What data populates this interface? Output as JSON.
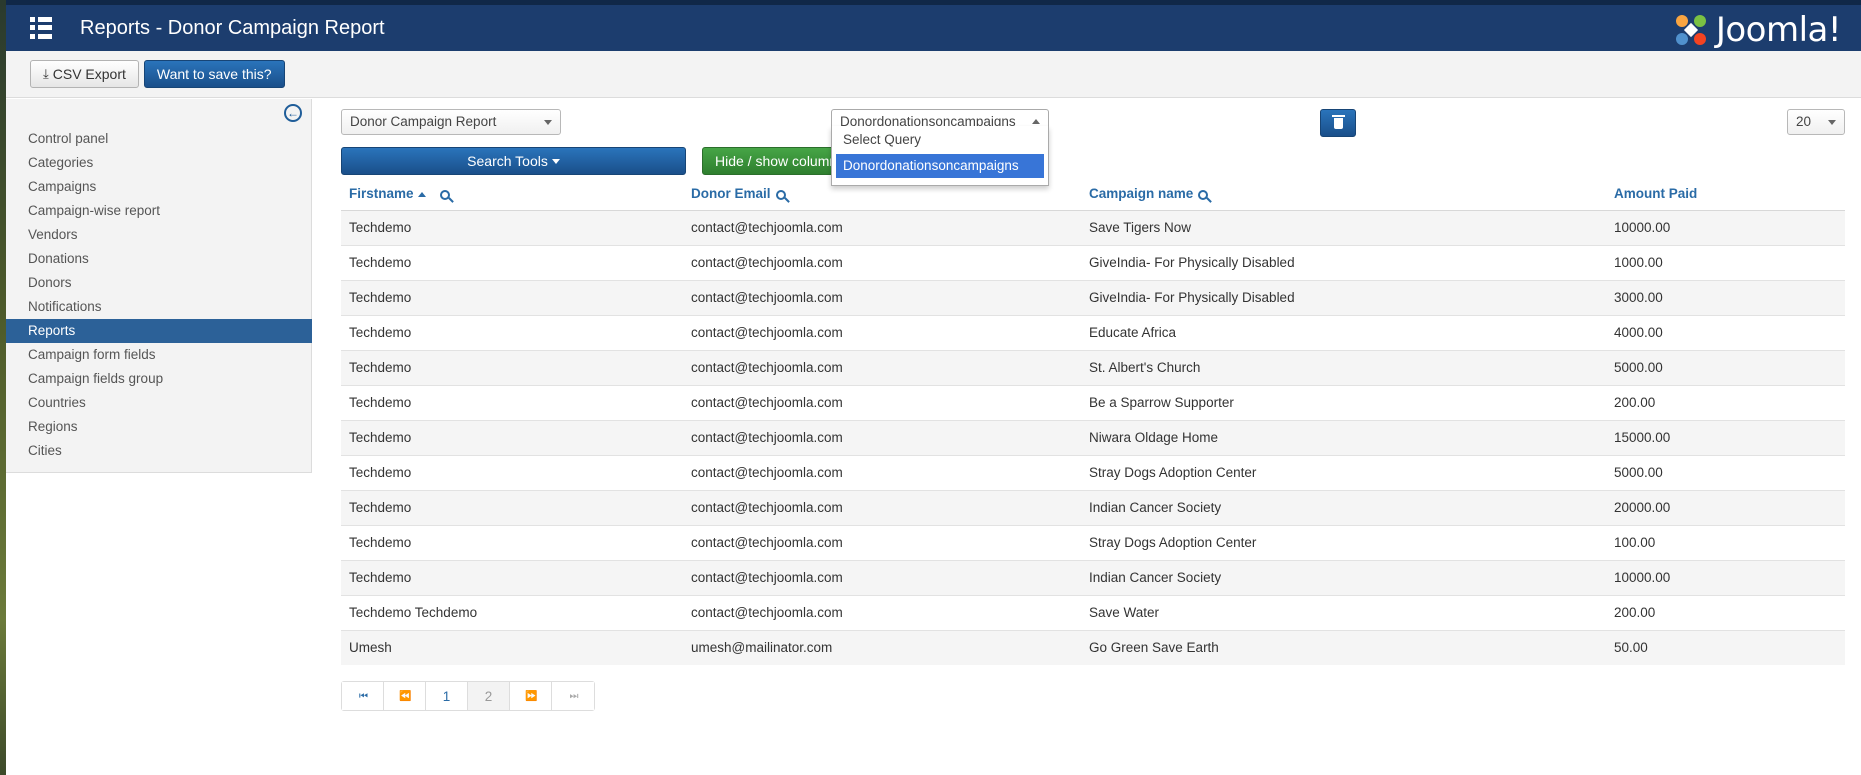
{
  "header": {
    "title": "Reports - Donor Campaign Report",
    "brand": "Joomla!",
    "menu_icon": "list-icon"
  },
  "toolbar": {
    "csv_label": "CSV Export",
    "save_label": "Want to save this?"
  },
  "sidebar": {
    "items": [
      {
        "label": "Control panel"
      },
      {
        "label": "Categories"
      },
      {
        "label": "Campaigns"
      },
      {
        "label": "Campaign-wise report"
      },
      {
        "label": "Vendors"
      },
      {
        "label": "Donations"
      },
      {
        "label": "Donors"
      },
      {
        "label": "Notifications"
      },
      {
        "label": "Reports",
        "active": true
      },
      {
        "label": "Campaign form fields"
      },
      {
        "label": "Campaign fields group"
      },
      {
        "label": "Countries"
      },
      {
        "label": "Regions"
      },
      {
        "label": "Cities"
      }
    ]
  },
  "filters": {
    "report_select": "Donor Campaign Report",
    "query_select": "Donordonationsoncampaigns",
    "query_options": [
      "Select Query",
      "Donordonationsoncampaigns"
    ],
    "limit_select": "20",
    "search_tools_label": "Search Tools",
    "hide_show_label": "Hide / show columns"
  },
  "table": {
    "headers": [
      "Firstname",
      "Donor Email",
      "Campaign name",
      "Amount Paid"
    ],
    "rows": [
      [
        "Techdemo",
        "contact@techjoomla.com",
        "Save Tigers Now",
        "10000.00"
      ],
      [
        "Techdemo",
        "contact@techjoomla.com",
        "GiveIndia- For Physically Disabled",
        "1000.00"
      ],
      [
        "Techdemo",
        "contact@techjoomla.com",
        "GiveIndia- For Physically Disabled",
        "3000.00"
      ],
      [
        "Techdemo",
        "contact@techjoomla.com",
        "Educate Africa",
        "4000.00"
      ],
      [
        "Techdemo",
        "contact@techjoomla.com",
        "St. Albert's Church",
        "5000.00"
      ],
      [
        "Techdemo",
        "contact@techjoomla.com",
        "Be a Sparrow Supporter",
        "200.00"
      ],
      [
        "Techdemo",
        "contact@techjoomla.com",
        "Niwara Oldage Home",
        "15000.00"
      ],
      [
        "Techdemo",
        "contact@techjoomla.com",
        "Stray Dogs Adoption Center",
        "5000.00"
      ],
      [
        "Techdemo",
        "contact@techjoomla.com",
        "Indian Cancer Society",
        "20000.00"
      ],
      [
        "Techdemo",
        "contact@techjoomla.com",
        "Stray Dogs Adoption Center",
        "100.00"
      ],
      [
        "Techdemo",
        "contact@techjoomla.com",
        "Indian Cancer Society",
        "10000.00"
      ],
      [
        "Techdemo Techdemo",
        "contact@techjoomla.com",
        "Save Water",
        "200.00"
      ],
      [
        "Umesh",
        "umesh@mailinator.com",
        "Go Green Save Earth",
        "50.00"
      ]
    ]
  },
  "pagination": {
    "pages": [
      "1",
      "2"
    ],
    "current": "2"
  },
  "colors": {
    "header_bg": "#1c3d6e",
    "primary": "#2c6198",
    "success": "#46a546",
    "link": "#2a6ba6"
  }
}
